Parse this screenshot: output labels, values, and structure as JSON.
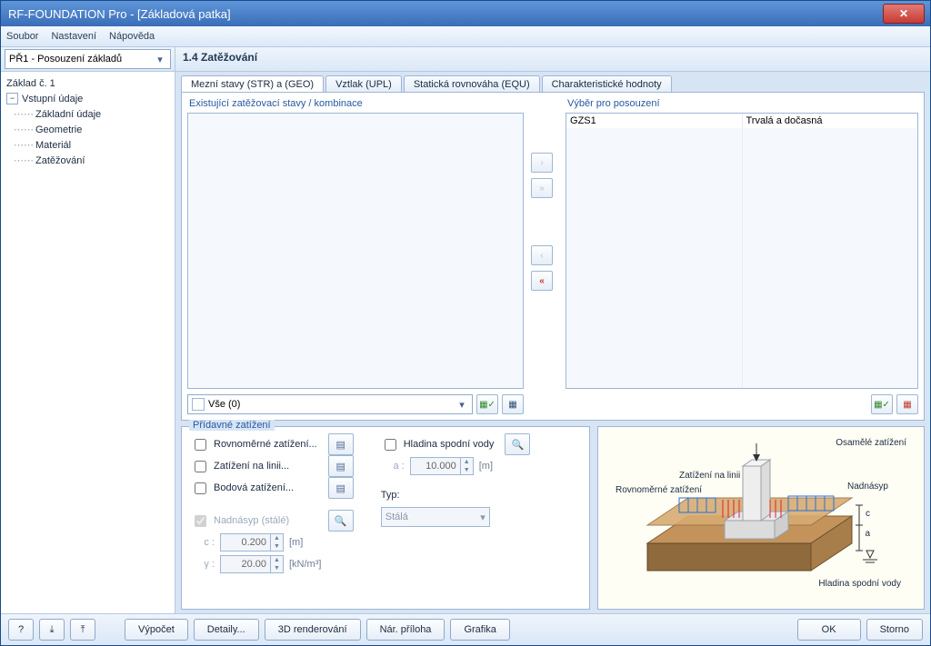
{
  "title": "RF-FOUNDATION Pro - [Základová patka]",
  "menu": {
    "file": "Soubor",
    "settings": "Nastavení",
    "help": "Nápověda"
  },
  "caseCombo": "PŘ1 - Posouzení základů",
  "sectionTitle": "1.4 Zatěžování",
  "tree": {
    "root": "Základ č. 1",
    "n1": "Vstupní údaje",
    "n1a": "Základní údaje",
    "n1b": "Geometrie",
    "n1c": "Materiál",
    "n1d": "Zatěžování"
  },
  "tabs": {
    "t1": "Mezní stavy (STR) a (GEO)",
    "t2": "Vztlak (UPL)",
    "t3": "Statická rovnováha (EQU)",
    "t4": "Charakteristické hodnoty"
  },
  "existingLabel": "Existující zatěžovací stavy /  kombinace",
  "selectLabel": "Výběr pro posouzení",
  "allCombo": "Vše (0)",
  "sel": {
    "tag": "G",
    "name": "ZS1",
    "type": "Trvalá a dočasná"
  },
  "additional": {
    "legend": "Přídavné zatížení",
    "uniform": "Rovnoměrné zatížení...",
    "line": "Zatížení na linii...",
    "point": "Bodová zatížení...",
    "overburden": "Nadnásyp (stálé)",
    "c_label": "c :",
    "c_value": "0.200",
    "c_unit": "[m]",
    "g_label": "γ :",
    "g_value": "20.00",
    "g_unit": "[kN/m³]",
    "water": "Hladina spodní vody",
    "a_label": "a :",
    "a_value": "10.000",
    "a_unit": "[m]",
    "type_label": "Typ:",
    "type_value": "Stálá"
  },
  "diagram": {
    "lPoint": "Osamělé zatížení",
    "lLine": "Zatížení na linii",
    "lUniform": "Rovnoměrné zatížení",
    "lOver": "Nadnásyp",
    "lWater": "Hladina spodní vody",
    "dc": "c",
    "da": "a"
  },
  "footer": {
    "calc": "Výpočet",
    "details": "Detaily...",
    "render": "3D renderování",
    "attach": "Nár. příloha",
    "graphics": "Grafika",
    "ok": "OK",
    "cancel": "Storno"
  },
  "icons": {
    "moveRight": "›",
    "moveAllRight": "»",
    "moveLeft": "‹",
    "moveAllLeft": "«",
    "check": "✓",
    "cfg": "▦"
  }
}
